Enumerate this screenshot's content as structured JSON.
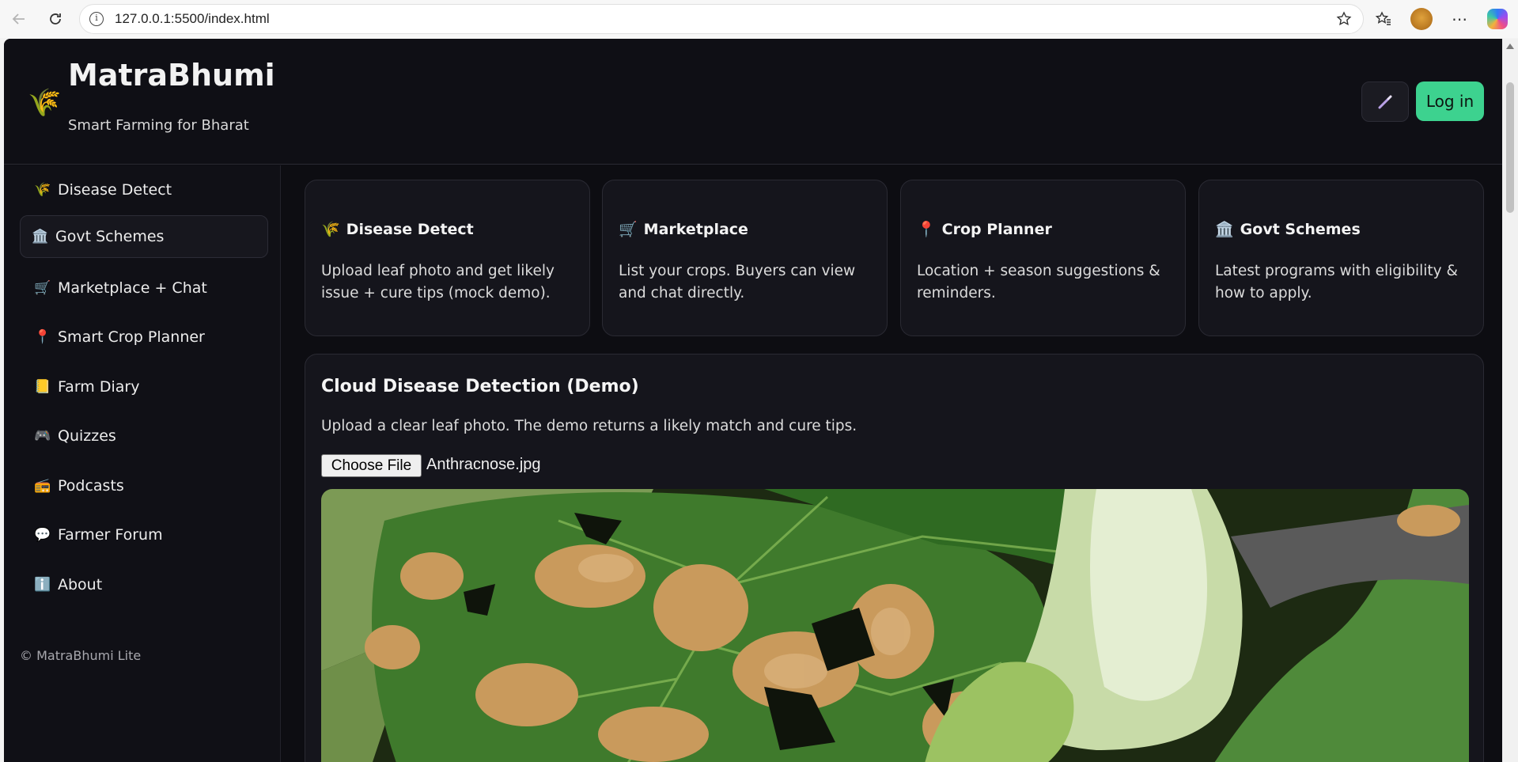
{
  "browser": {
    "url": "127.0.0.1:5500/index.html"
  },
  "header": {
    "logo_icon": "wheat-icon",
    "brand": "MatraBhumi",
    "tagline": "Smart Farming for Bharat",
    "theme_toggle_icon": "wand-icon",
    "login_label": "Log in",
    "login_color": "#3dd28f"
  },
  "sidebar": {
    "items": [
      {
        "emoji": "🌾",
        "label": "Disease Detect",
        "active": false
      },
      {
        "emoji": "🏛️",
        "label": "Govt Schemes",
        "active": true
      },
      {
        "emoji": "🛒",
        "label": "Marketplace + Chat",
        "active": false
      },
      {
        "emoji": "📍",
        "label": "Smart Crop Planner",
        "active": false
      },
      {
        "emoji": "📒",
        "label": "Farm Diary",
        "active": false
      },
      {
        "emoji": "🎮",
        "label": "Quizzes",
        "active": false
      },
      {
        "emoji": "📻",
        "label": "Podcasts",
        "active": false
      },
      {
        "emoji": "💬",
        "label": "Farmer Forum",
        "active": false
      },
      {
        "emoji": "ℹ️",
        "label": "About",
        "active": false
      }
    ],
    "footer": "© MatraBhumi Lite"
  },
  "cards": [
    {
      "emoji": "🌾",
      "title": "Disease Detect",
      "desc": "Upload leaf photo and get likely issue + cure tips (mock demo)."
    },
    {
      "emoji": "🛒",
      "title": "Marketplace",
      "desc": "List your crops. Buyers can view and chat directly."
    },
    {
      "emoji": "📍",
      "title": "Crop Planner",
      "desc": "Location + season suggestions & reminders."
    },
    {
      "emoji": "🏛️",
      "title": "Govt Schemes",
      "desc": "Latest programs with eligibility & how to apply."
    }
  ],
  "detection": {
    "title": "Cloud Disease Detection (Demo)",
    "desc": "Upload a clear leaf photo. The demo returns a likely match and cure tips.",
    "file_button": "Choose File",
    "file_name": "Anthracnose.jpg"
  }
}
